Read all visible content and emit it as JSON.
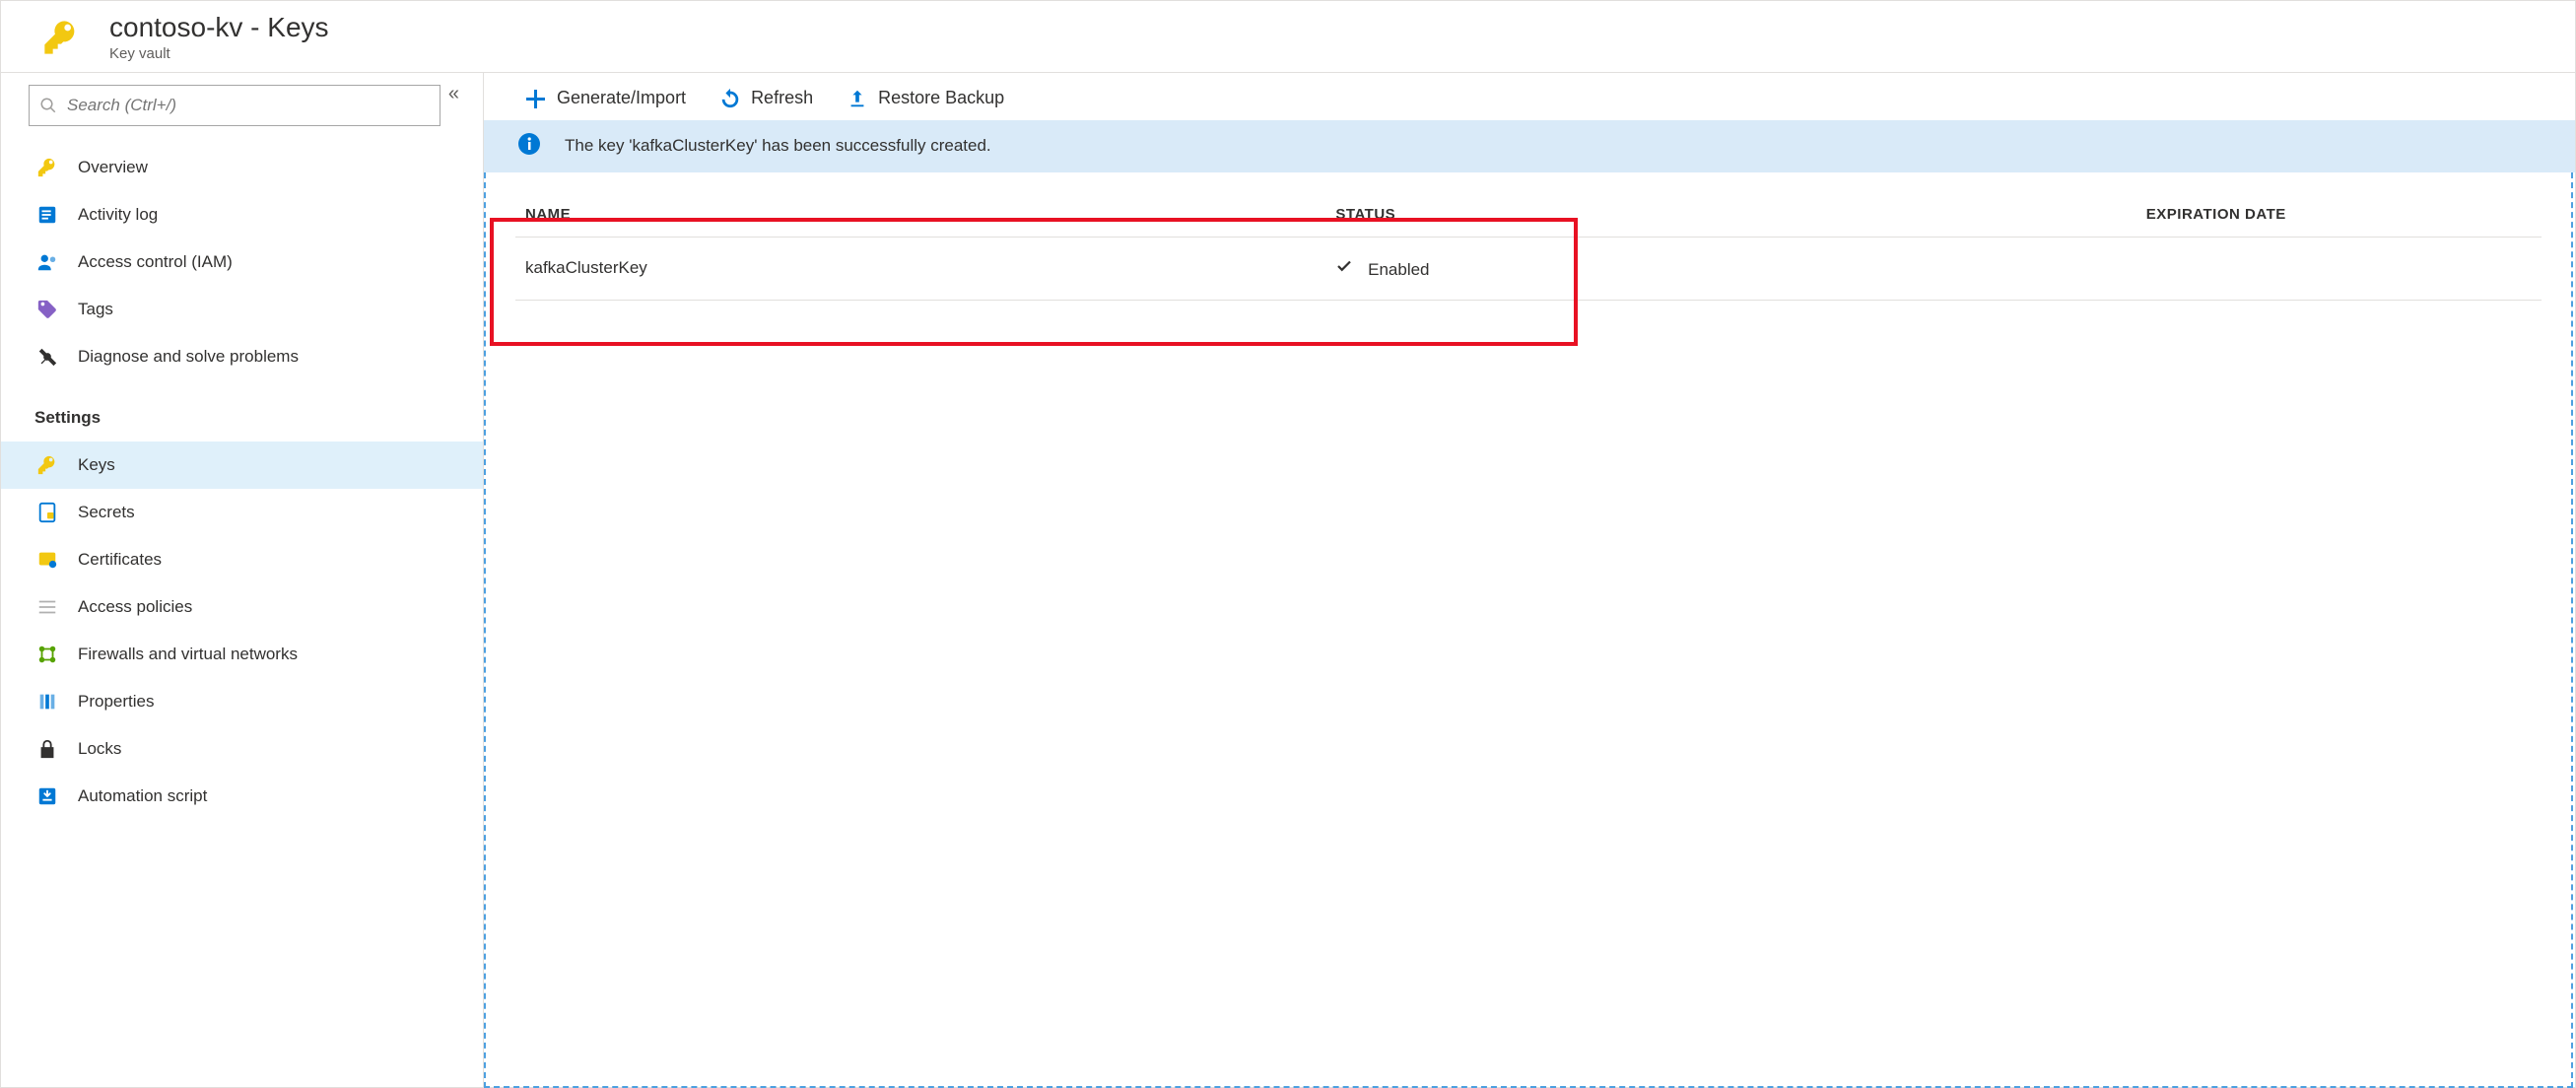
{
  "header": {
    "title": "contoso-kv - Keys",
    "subtitle": "Key vault"
  },
  "sidebar": {
    "search_placeholder": "Search (Ctrl+/)",
    "groups": [
      {
        "label": null,
        "items": [
          {
            "icon": "key-icon",
            "label": "Overview"
          },
          {
            "icon": "activity-log-icon",
            "label": "Activity log"
          },
          {
            "icon": "access-control-icon",
            "label": "Access control (IAM)"
          },
          {
            "icon": "tag-icon",
            "label": "Tags"
          },
          {
            "icon": "diagnose-icon",
            "label": "Diagnose and solve problems"
          }
        ]
      },
      {
        "label": "Settings",
        "items": [
          {
            "icon": "key-icon",
            "label": "Keys",
            "selected": true
          },
          {
            "icon": "secrets-icon",
            "label": "Secrets"
          },
          {
            "icon": "certificates-icon",
            "label": "Certificates"
          },
          {
            "icon": "access-policies-icon",
            "label": "Access policies"
          },
          {
            "icon": "firewall-icon",
            "label": "Firewalls and virtual networks"
          },
          {
            "icon": "properties-icon",
            "label": "Properties"
          },
          {
            "icon": "lock-icon",
            "label": "Locks"
          },
          {
            "icon": "automation-icon",
            "label": "Automation script"
          }
        ]
      }
    ]
  },
  "toolbar": {
    "generate": "Generate/Import",
    "refresh": "Refresh",
    "restore": "Restore Backup"
  },
  "notification": {
    "message": "The key 'kafkaClusterKey' has been successfully created."
  },
  "table": {
    "columns": {
      "name": "NAME",
      "status": "STATUS",
      "expiration": "EXPIRATION DATE"
    },
    "rows": [
      {
        "name": "kafkaClusterKey",
        "status": "Enabled",
        "expiration": ""
      }
    ]
  }
}
